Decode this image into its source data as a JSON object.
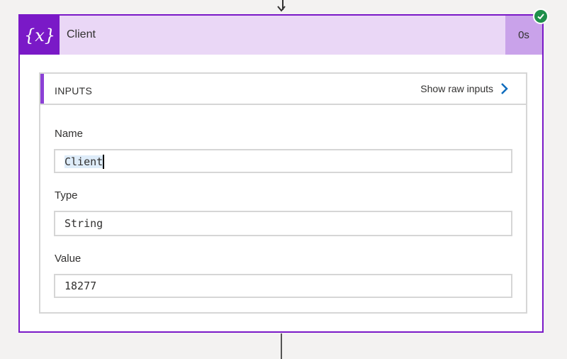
{
  "card": {
    "icon_text": "{x}",
    "title": "Client",
    "duration": "0s",
    "status": "succeeded",
    "accent_color": "#7a19c7",
    "header_color": "#ead7f6"
  },
  "inputs": {
    "heading": "INPUTS",
    "raw_link_label": "Show raw inputs",
    "fields": [
      {
        "label": "Name",
        "value": "Client"
      },
      {
        "label": "Type",
        "value": "String"
      },
      {
        "label": "Value",
        "value": "18277"
      }
    ]
  }
}
